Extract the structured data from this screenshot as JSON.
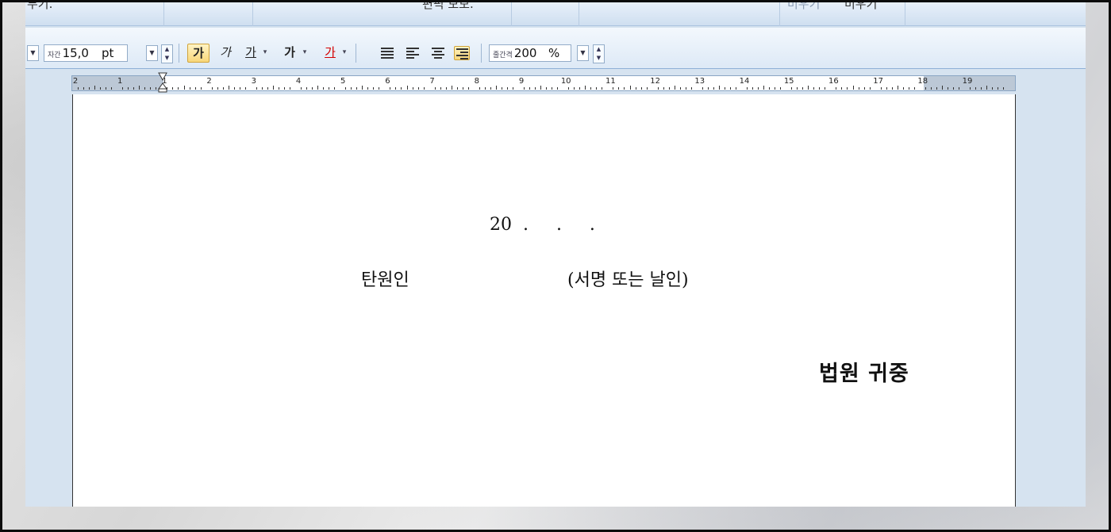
{
  "menu_fragments": {
    "left": "무기.",
    "middle": "편픽 모모.",
    "right_dim": "미우기",
    "right": "미우기"
  },
  "toolbar": {
    "font_size_icon_label": "자간",
    "font_size_value": "15,0",
    "font_size_unit": "pt",
    "bold_label": "가",
    "italic_label": "가",
    "underline_label": "가",
    "strike_label": "가",
    "color_label": "가",
    "line_spacing_icon_label": "줄간격",
    "line_spacing_value": "200",
    "line_spacing_unit": "%",
    "accent_active": "#f8d77a",
    "font_color_underline": "#d40000"
  },
  "ruler": {
    "labels": [
      "2",
      "1",
      "1",
      "2",
      "3",
      "4",
      "5",
      "6",
      "7",
      "8",
      "9",
      "10",
      "11",
      "12",
      "13",
      "14",
      "15",
      "16",
      "17",
      "18",
      "19"
    ]
  },
  "document": {
    "date_line": "20  .     .     .",
    "signer_label": "탄원인",
    "signature_note": "(서명 또는 날인)",
    "court_line": "법원 귀중"
  }
}
